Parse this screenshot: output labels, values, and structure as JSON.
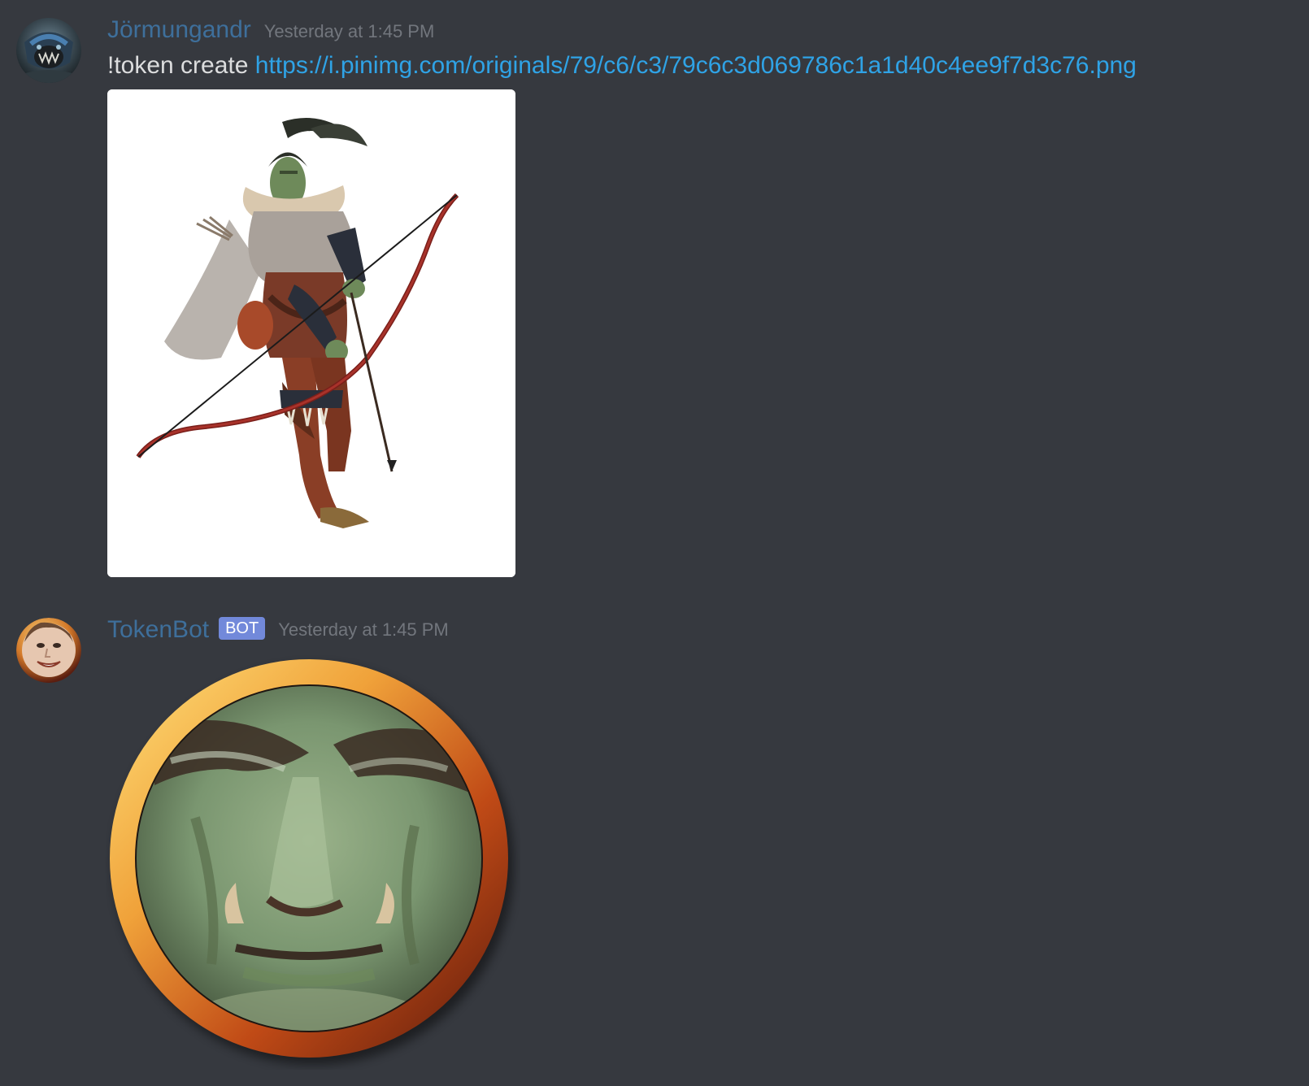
{
  "messages": [
    {
      "author": "Jörmungandr",
      "timestamp": "Yesterday at 1:45 PM",
      "text_prefix": "!token create ",
      "link": "https://i.pinimg.com/originals/79/c6/c3/79c6c3d069786c1a1d40c4ee9f7d3c76.png",
      "avatar_icon": "dark-creature-avatar-icon",
      "attachment": "orc-archer-with-bow-image"
    },
    {
      "author": "TokenBot",
      "badge": "BOT",
      "timestamp": "Yesterday at 1:45 PM",
      "avatar_icon": "smiling-face-avatar-icon",
      "attachment": "orc-face-token-image"
    }
  ],
  "colors": {
    "background": "#36393f",
    "username": "#3e6f9b",
    "timestamp": "#72767d",
    "text": "#dcddde",
    "link": "#2fa3e6",
    "bot_badge": "#7289da"
  }
}
